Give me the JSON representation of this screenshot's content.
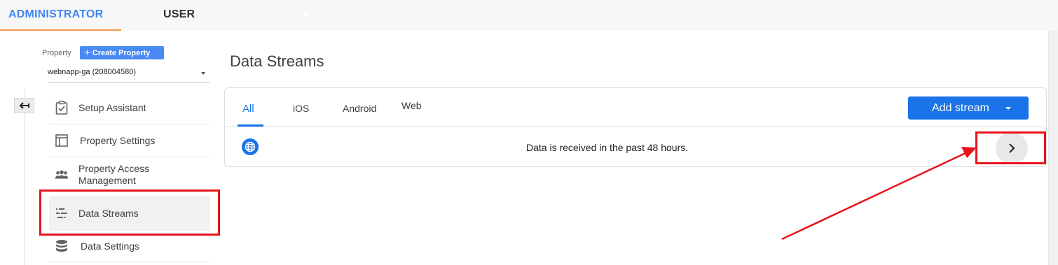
{
  "top_tabs": {
    "admin_label": "ADMINISTRATOR",
    "user_label": "USER"
  },
  "sidebar": {
    "property_label": "Property",
    "create_property_label": "Create Property",
    "selected_property": "webnapp-ga (208004580)",
    "items": [
      {
        "label": "Setup Assistant",
        "icon": "clipboard-check-icon"
      },
      {
        "label": "Property Settings",
        "icon": "layout-icon"
      },
      {
        "label": "Property Access Management",
        "icon": "people-icon"
      },
      {
        "label": "Data Streams",
        "icon": "streams-icon",
        "active": true
      },
      {
        "label": "Data Settings",
        "icon": "database-icon"
      }
    ]
  },
  "main": {
    "title": "Data Streams",
    "tabs": [
      {
        "label": "All",
        "active": true
      },
      {
        "label": "iOS"
      },
      {
        "label": "Android"
      },
      {
        "label": "Web"
      }
    ],
    "add_stream_label": "Add stream",
    "stream_row": {
      "status_text": "Data is received in the past 48 hours.",
      "icon": "globe-icon"
    }
  },
  "colors": {
    "accent_blue": "#1a73e8",
    "admin_tab_blue": "#4285f4",
    "active_tab_underline": "#f2994a",
    "annotation_red": "#e8141b"
  }
}
